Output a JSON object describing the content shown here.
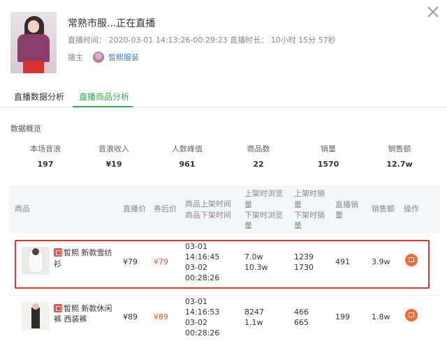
{
  "header": {
    "title": "常熟市服...正在直播",
    "meta": "直播时间： 2020-03-01 14:13:26-00:29:23  直播时长：  10小时 15分 57秒",
    "anchor_label": "播主",
    "anchor_name": "皙熙服装"
  },
  "tabs": [
    {
      "label": "直播数据分析",
      "active": false
    },
    {
      "label": "直播商品分析",
      "active": true
    }
  ],
  "accent_color": "#2fae4f",
  "overview": {
    "title": "数据概览",
    "stats": [
      {
        "label": "本场音浪",
        "value": "197"
      },
      {
        "label": "音浪收入",
        "value": "¥19"
      },
      {
        "label": "人数峰值",
        "value": "961"
      },
      {
        "label": "商品数",
        "value": "22"
      },
      {
        "label": "销量",
        "value": "1570"
      },
      {
        "label": "销售额",
        "value": "12.7w"
      }
    ]
  },
  "table": {
    "headers": {
      "product": "商品",
      "live_price": "直播价",
      "coupon_price": "券后价",
      "time_1": "商品上架时间",
      "time_2": "商品下架时间",
      "views_1": "上架时浏览",
      "views_2": "量",
      "views_3": "下架时浏览",
      "views_4": "量",
      "sales_1": "上架时销",
      "sales_2": "量",
      "sales_3": "下架时销",
      "sales_4": "量",
      "live_sales_1": "直播销",
      "live_sales_2": "量",
      "revenue": "销售额",
      "action": "操作"
    },
    "rows": [
      {
        "name_1": "皙熙 新款雪纺",
        "name_2": "衫",
        "live_price": "¥79",
        "coupon_price": "¥79",
        "t1": "03-01",
        "t2": "14:16:45",
        "t3": "03-02",
        "t4": "00:28:26",
        "views_on": "7.0w",
        "views_off": "10.3w",
        "sales_on": "1239",
        "sales_off": "1730",
        "live_sales": "491",
        "revenue": "3.9w",
        "highlighted": true
      },
      {
        "name_1": "皙熙 新款休闲",
        "name_2": "裤 西装裤",
        "live_price": "¥89",
        "coupon_price": "¥89",
        "t1": "03-01",
        "t2": "14:16:53",
        "t3": "03-02",
        "t4": "00:28:26",
        "views_on": "8247",
        "views_off": "1.1w",
        "sales_on": "466",
        "sales_off": "665",
        "live_sales": "199",
        "revenue": "1.8w",
        "highlighted": false
      }
    ]
  }
}
